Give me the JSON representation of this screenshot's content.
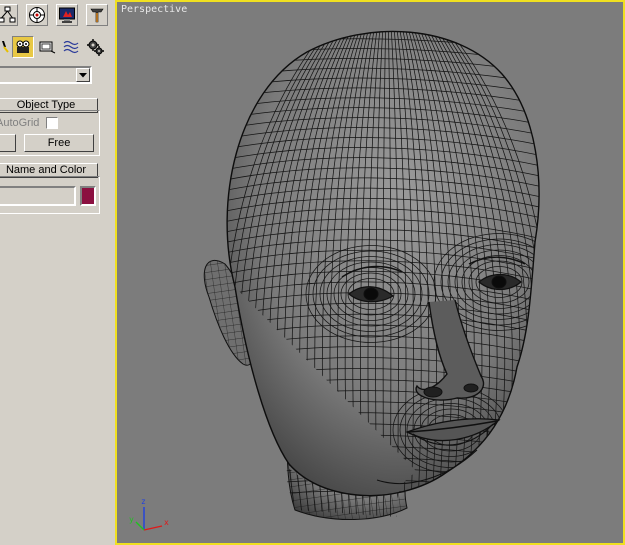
{
  "toolbar": {
    "row1": [
      {
        "icon": "hierarchy-icon"
      },
      {
        "icon": "motion-icon"
      },
      {
        "icon": "display-icon"
      },
      {
        "icon": "utilities-hammer-icon"
      }
    ],
    "row2": [
      {
        "icon": "light-icon"
      },
      {
        "icon": "camera-icon",
        "active": true
      },
      {
        "icon": "helper-icon"
      },
      {
        "icon": "spacewarp-icon"
      },
      {
        "icon": "systems-gear-icon"
      }
    ]
  },
  "category_dropdown": {
    "value": ""
  },
  "object_type": {
    "title": "Object Type",
    "autogrid_label": "AutoGrid",
    "autogrid_checked": false,
    "buttons": [
      "",
      "Free"
    ]
  },
  "name_and_color": {
    "title": "Name and Color",
    "name_value": "",
    "color": "#8b1040"
  },
  "viewport": {
    "label": "Perspective",
    "border_color": "#f0e020",
    "background": "#7c7c7c",
    "axes": {
      "x": "x",
      "y": "y",
      "z": "z",
      "x_color": "#e01818",
      "y_color": "#20c020",
      "z_color": "#2040e0"
    }
  }
}
